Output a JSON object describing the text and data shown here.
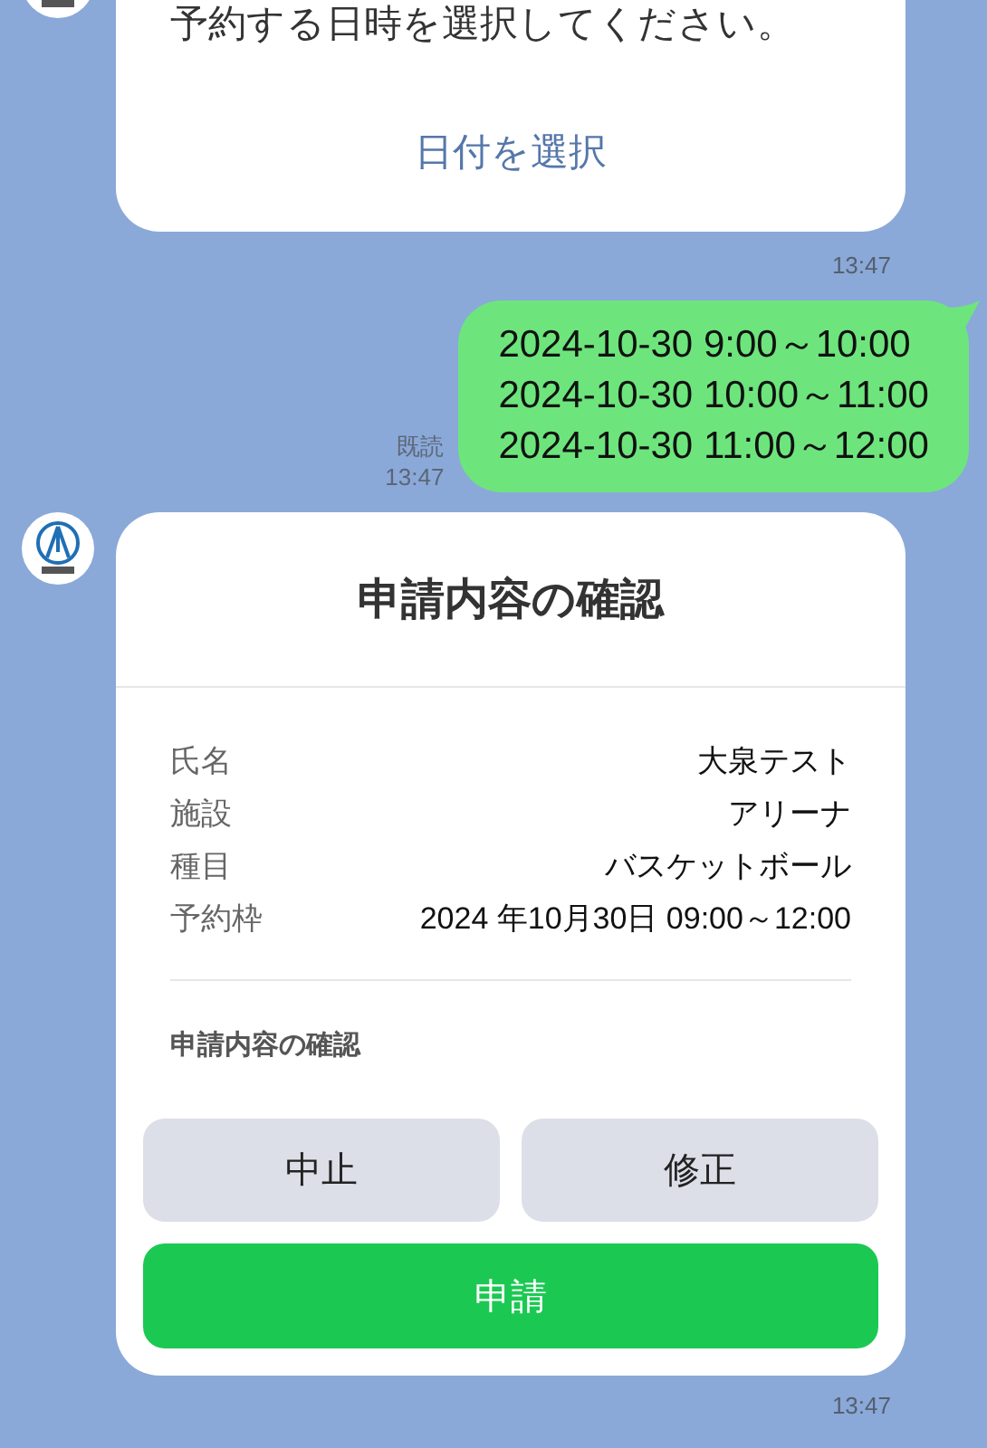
{
  "messages": [
    {
      "kind": "bot_card",
      "text": "予約する日時を選択してください。",
      "action": "日付を選択",
      "time": "13:47"
    },
    {
      "kind": "user",
      "lines": [
        "2024-10-30 9:00～10:00",
        "2024-10-30 10:00～11:00",
        "2024-10-30 11:00～12:00"
      ],
      "read": "既読",
      "time": "13:47"
    },
    {
      "kind": "confirm_card",
      "title": "申請内容の確認",
      "fields": [
        {
          "label": "氏名",
          "value": "大泉テスト"
        },
        {
          "label": "施設",
          "value": "アリーナ"
        },
        {
          "label": "種目",
          "value": "バスケットボール"
        },
        {
          "label": "予約枠",
          "value": "2024 年10月30日 09:00～12:00"
        }
      ],
      "section_label": "申請内容の確認",
      "buttons": [
        {
          "label": "中止",
          "kind": "secondary"
        },
        {
          "label": "修正",
          "kind": "secondary"
        },
        {
          "label": "申請",
          "kind": "primary"
        }
      ],
      "time": "13:47"
    }
  ]
}
